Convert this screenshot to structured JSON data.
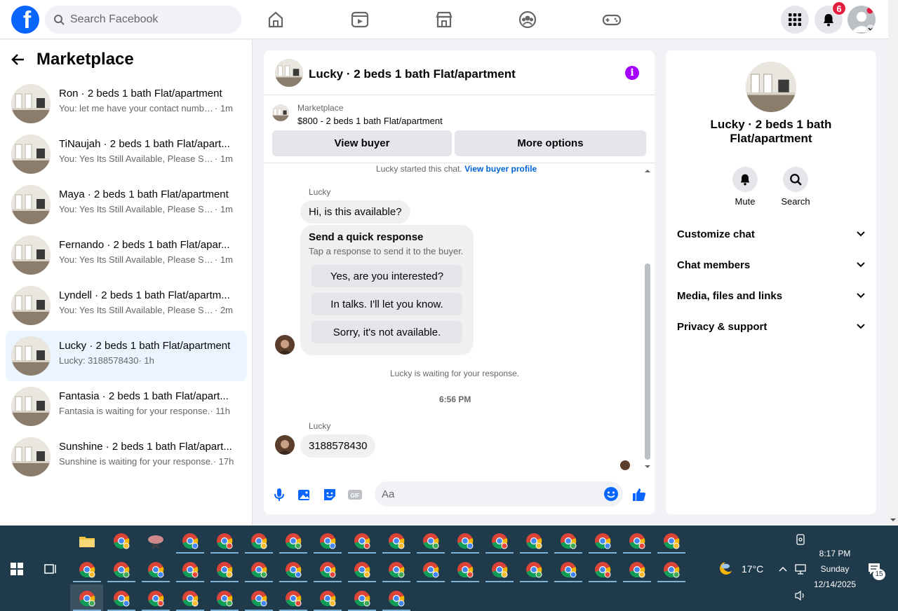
{
  "topbar": {
    "search_placeholder": "Search Facebook",
    "notification_count": "6",
    "nav_icons": [
      "home-icon",
      "video-icon",
      "marketplace-icon",
      "groups-icon",
      "gaming-icon"
    ]
  },
  "sidebar": {
    "title": "Marketplace",
    "conversations": [
      {
        "title": "Ron · 2 beds 1 bath Flat/apartment",
        "preview": "You: let me have your contact numbe...",
        "time": "· 1m",
        "active": false
      },
      {
        "title": "TiNaujah · 2 beds 1 bath Flat/apart...",
        "preview": "You: Yes Its Still Available, Please Sen...",
        "time": "· 1m",
        "active": false
      },
      {
        "title": "Maya · 2 beds 1 bath Flat/apartment",
        "preview": "You: Yes Its Still Available, Please Sen...",
        "time": "· 1m",
        "active": false
      },
      {
        "title": "Fernando · 2 beds 1 bath Flat/apar...",
        "preview": "You: Yes Its Still Available, Please Sen...",
        "time": "· 1m",
        "active": false
      },
      {
        "title": "Lyndell · 2 beds 1 bath Flat/apartm...",
        "preview": "You: Yes Its Still Available, Please Sen...",
        "time": "· 2m",
        "active": false
      },
      {
        "title": "Lucky · 2 beds 1 bath Flat/apartment",
        "preview": "Lucky: 3188578430",
        "time": "· 1h",
        "active": true
      },
      {
        "title": "Fantasia · 2 beds 1 bath Flat/apart...",
        "preview": "Fantasia is waiting for your response.",
        "time": "· 11h",
        "active": false
      },
      {
        "title": "Sunshine · 2 beds 1 bath Flat/apart...",
        "preview": "Sunshine is waiting for your response.",
        "time": "· 17h",
        "active": false
      }
    ]
  },
  "chat": {
    "title": "Lucky · 2 beds 1 bath Flat/apartment",
    "listing_label": "Marketplace",
    "listing_detail": "$800 - 2 beds 1 bath Flat/apartment",
    "view_buyer": "View buyer",
    "more_options": "More options",
    "started_text": "Lucky started this chat.",
    "view_profile_link": "View buyer profile",
    "sender_name": "Lucky",
    "first_message": "Hi, is this available?",
    "quick_title": "Send a quick response",
    "quick_subtitle": "Tap a response to send it to the buyer.",
    "quick_responses": [
      "Yes, are you interested?",
      "In talks. I'll let you know.",
      "Sorry, it's not available."
    ],
    "waiting_text": "Lucky is waiting for your response.",
    "timestamp": "6:56 PM",
    "last_message": "3188578430",
    "composer_placeholder": "Aa"
  },
  "details": {
    "title": "Lucky · 2 beds 1 bath Flat/apartment",
    "mute_label": "Mute",
    "search_label": "Search",
    "sections": [
      "Customize chat",
      "Chat members",
      "Media, files and links",
      "Privacy & support"
    ]
  },
  "taskbar": {
    "temperature": "17°C",
    "time": "8:17 PM",
    "day": "Sunday",
    "date": "12/14/2025",
    "notif_count": "15"
  }
}
